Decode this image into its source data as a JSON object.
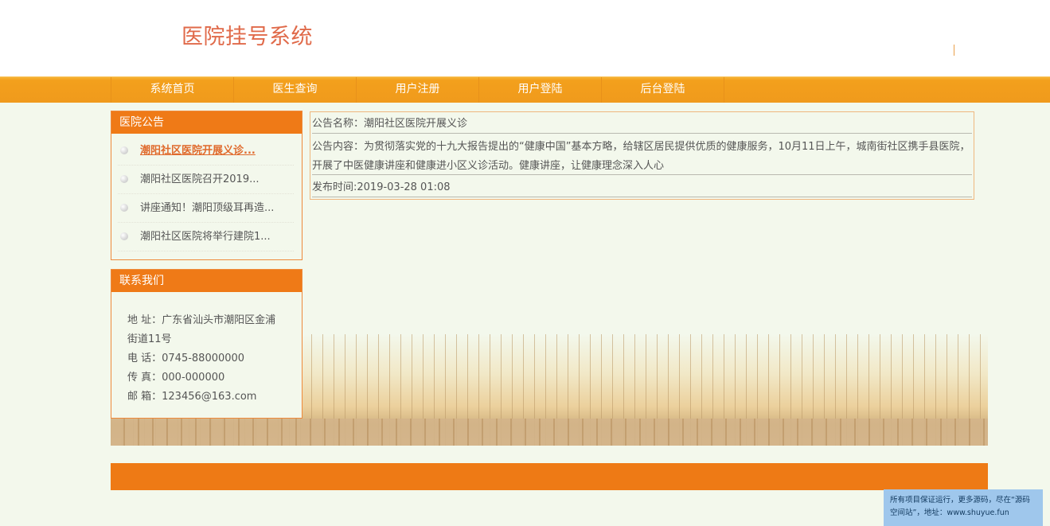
{
  "site": {
    "title": "医院挂号系统"
  },
  "nav": {
    "items": [
      "系统首页",
      "医生查询",
      "用户注册",
      "用户登陆",
      "后台登陆"
    ]
  },
  "notice_panel": {
    "title": "医院公告",
    "items": [
      {
        "text": "潮阳社区医院开展义诊...",
        "active": true
      },
      {
        "text": "潮阳社区医院召开2019...",
        "active": false
      },
      {
        "text": "讲座通知！潮阳顶级耳再造...",
        "active": false
      },
      {
        "text": "潮阳社区医院将举行建院1...",
        "active": false
      }
    ]
  },
  "contact_panel": {
    "title": "联系我们",
    "address_line1": "地 址：广东省汕头市潮阳区金浦",
    "address_line2": "街道11号",
    "phone": "电 话：0745-88000000",
    "fax": "传 真：000-000000",
    "email": "邮 箱：123456@163.com"
  },
  "article": {
    "name_line": "公告名称：潮阳社区医院开展义诊",
    "content_line": "公告内容：为贯彻落实党的十九大报告提出的“健康中国”基本方略，给辖区居民提供优质的健康服务，10月11日上午，城南街社区携手县医院，开展了中医健康讲座和健康进小区义诊活动。健康讲座，让健康理念深入人心",
    "time_line": "发布时间:2019-03-28 01:08"
  },
  "watermark": {
    "line1": "所有项目保证运行，更多源码，尽在“源码",
    "line2": "空间站”，地址：www.shuyue.fun"
  }
}
